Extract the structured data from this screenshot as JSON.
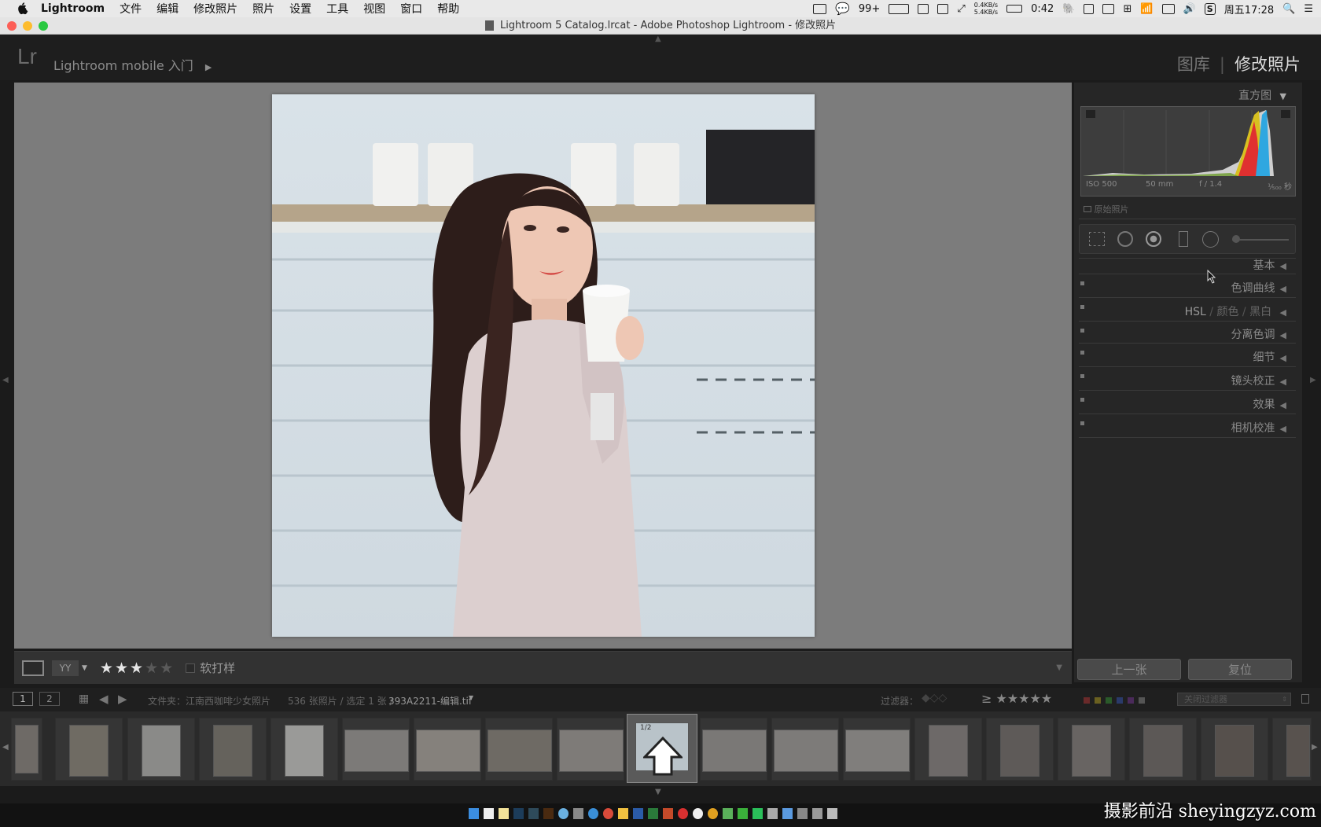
{
  "menubar": {
    "items": [
      "Lightroom",
      "文件",
      "编辑",
      "修改照片",
      "照片",
      "设置",
      "工具",
      "视图",
      "窗口",
      "帮助"
    ],
    "wechat_badge": "99+",
    "net_up": "0.4KB/s",
    "net_down": "5.4KB/s",
    "battery": "0:42",
    "clock": "周五17:28"
  },
  "window": {
    "title": "Lightroom 5 Catalog.lrcat - Adobe Photoshop Lightroom - 修改照片"
  },
  "topbar": {
    "logo": "Lr",
    "identity": "Lightroom mobile 入门",
    "modules": [
      "图库",
      "修改照片"
    ]
  },
  "right_panel": {
    "histogram_title": "直方图",
    "exif": {
      "iso": "ISO 500",
      "focal": "50 mm",
      "aperture": "f / 1.4",
      "shutter": "¹⁄₅₀₀ 秒"
    },
    "original_photo": "原始照片",
    "sections": [
      "基本",
      "色调曲线",
      "HSL",
      "颜色",
      "黑白",
      "分离色调",
      "细节",
      "镜头校正",
      "效果",
      "相机校准"
    ],
    "buttons": {
      "previous": "上一张",
      "reset": "复位"
    }
  },
  "toolbar": {
    "rating_filled": 3,
    "rating_total": 5,
    "soft_proof": "软打样"
  },
  "filmbar": {
    "page1": "1",
    "page2": "2",
    "folder": "文件夹：江南西咖啡少女照片",
    "count": "536 张照片 / 选定 1 张 /",
    "filename": "393A2211-编辑.tif",
    "filter_label": "过滤器：",
    "filter_off": "关闭过滤器",
    "selected_tag": "1/2"
  },
  "watermark": "摄影前沿 sheyingzyz.com",
  "colors": {
    "accent": "#dcdcdc",
    "panel": "#262626",
    "view_bg": "#7c7c7c"
  }
}
